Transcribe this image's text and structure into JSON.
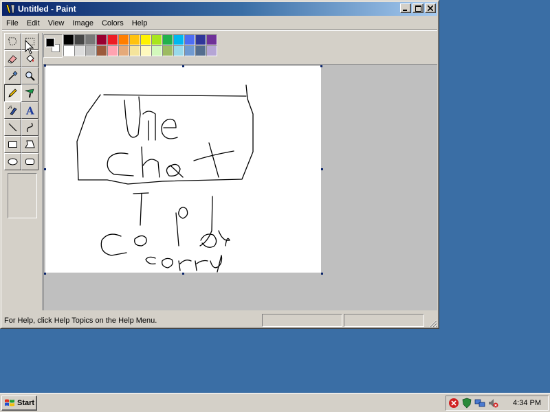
{
  "window": {
    "title": "Untitled - Paint"
  },
  "menu": [
    "File",
    "Edit",
    "View",
    "Image",
    "Colors",
    "Help"
  ],
  "tools": [
    {
      "name": "free-form-select-tool"
    },
    {
      "name": "select-tool"
    },
    {
      "name": "eraser-tool"
    },
    {
      "name": "fill-with-color-tool"
    },
    {
      "name": "pick-color-tool"
    },
    {
      "name": "magnifier-tool"
    },
    {
      "name": "pencil-tool",
      "active": true
    },
    {
      "name": "brush-tool"
    },
    {
      "name": "airbrush-tool"
    },
    {
      "name": "text-tool",
      "glyph": "A"
    },
    {
      "name": "line-tool"
    },
    {
      "name": "curve-tool"
    },
    {
      "name": "rectangle-tool"
    },
    {
      "name": "polygon-tool"
    },
    {
      "name": "ellipse-tool"
    },
    {
      "name": "rounded-rectangle-tool"
    }
  ],
  "colors": {
    "foreground": "#000000",
    "background": "#ffffff",
    "palette_row1": [
      "#000000",
      "#464646",
      "#787878",
      "#990030",
      "#ed1c24",
      "#ff7e00",
      "#ffc20e",
      "#fff200",
      "#a8e61d",
      "#22b14c",
      "#00b7ef",
      "#4d6df3",
      "#2f3699",
      "#6f3198"
    ],
    "palette_row2": [
      "#ffffff",
      "#dcdcdc",
      "#b4b4b4",
      "#9c5a3c",
      "#ffa3b1",
      "#e5aa7a",
      "#f5e49c",
      "#fff9bd",
      "#d3f9bc",
      "#9dbb61",
      "#99d9ea",
      "#709ad1",
      "#546d8e",
      "#b5a5d5"
    ]
  },
  "status": {
    "help_text": "For Help, click Help Topics on the Help Menu."
  },
  "taskbar": {
    "start_label": "Start",
    "clock": "4:34 PM"
  }
}
